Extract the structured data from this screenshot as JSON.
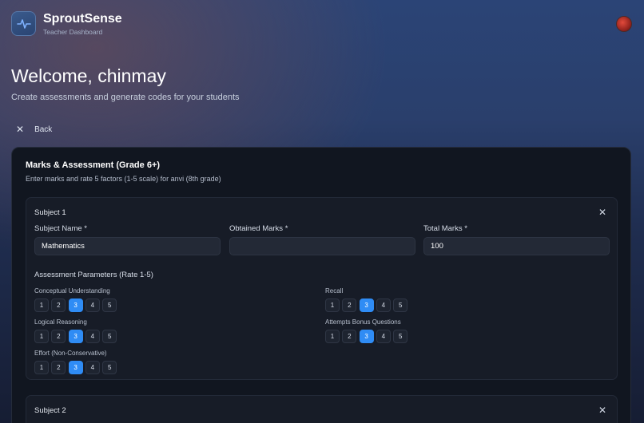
{
  "app": {
    "name": "SproutSense",
    "subtitle": "Teacher Dashboard"
  },
  "page": {
    "welcome": "Welcome, chinmay",
    "subtitle": "Create assessments and generate codes for your students",
    "back_label": "Back"
  },
  "card": {
    "title": "Marks & Assessment (Grade 6+)",
    "description": "Enter marks and rate 5 factors (1-5 scale) for anvi (8th grade)"
  },
  "subject1": {
    "title": "Subject 1",
    "subject_name_label": "Subject Name *",
    "subject_name_value": "Mathematics",
    "obtained_label": "Obtained Marks *",
    "obtained_value": "",
    "total_label": "Total Marks *",
    "total_value": "100",
    "params_title": "Assessment Parameters (Rate 1-5)",
    "params": [
      {
        "label": "Conceptual Understanding",
        "selected": 3
      },
      {
        "label": "Recall",
        "selected": 3
      },
      {
        "label": "Logical Reasoning",
        "selected": 3
      },
      {
        "label": "Attempts Bonus Questions",
        "selected": 3
      },
      {
        "label": "Effort (Non-Conservative)",
        "selected": 3
      }
    ]
  },
  "subject2": {
    "title": "Subject 2"
  },
  "rating_scale": [
    "1",
    "2",
    "3",
    "4",
    "5"
  ],
  "colors": {
    "accent": "#2f8cf5",
    "card_bg": "#111620",
    "subject_bg": "#171c27"
  },
  "icons": {
    "logo": "pulse-icon",
    "close": "close-icon",
    "back": "close-icon"
  }
}
